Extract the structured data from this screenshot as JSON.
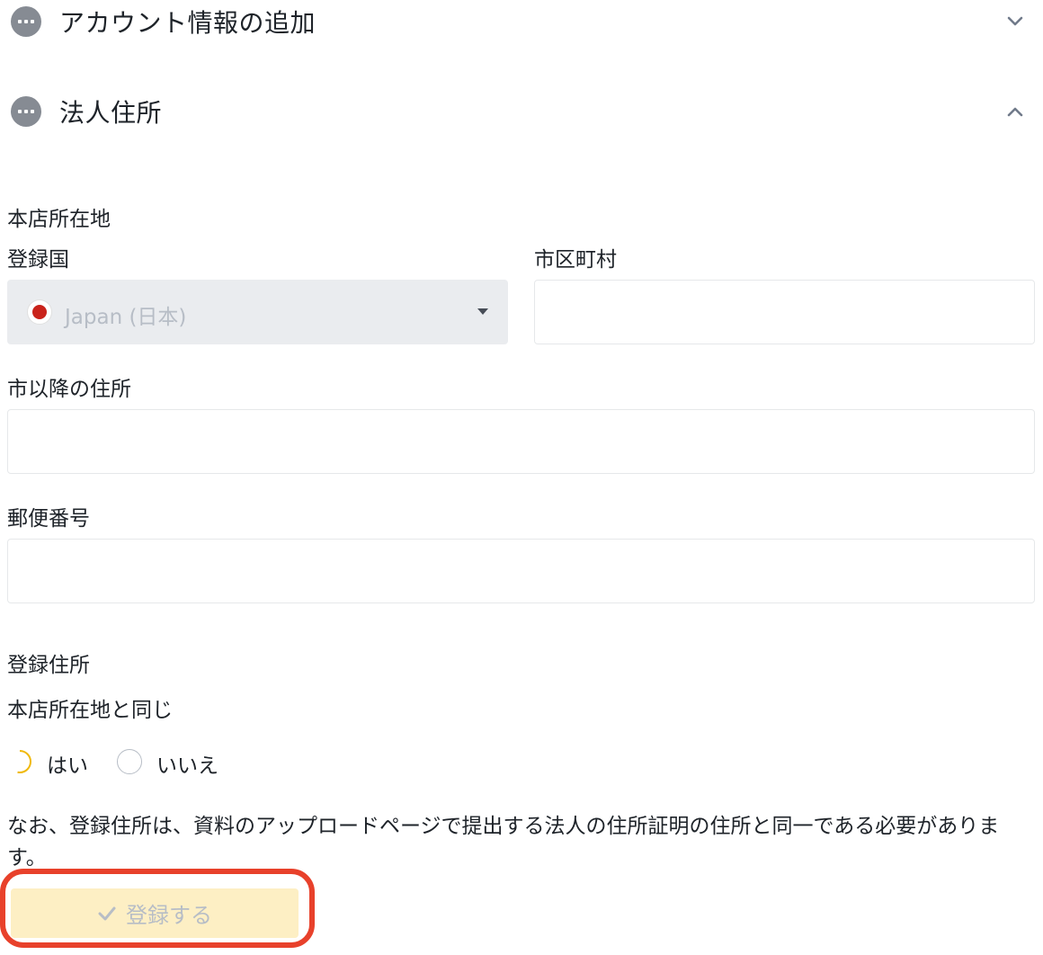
{
  "sections": {
    "account_info": {
      "title": "アカウント情報の追加",
      "expanded": false
    },
    "corporate_address": {
      "title": "法人住所",
      "expanded": true
    }
  },
  "form": {
    "head_office_heading": "本店所在地",
    "country": {
      "label": "登録国",
      "value": "Japan (日本)",
      "flag": "japan-flag-icon"
    },
    "city": {
      "label": "市区町村",
      "value": "",
      "placeholder": ""
    },
    "address_after_city": {
      "label": "市以降の住所",
      "value": "",
      "placeholder": ""
    },
    "postal_code": {
      "label": "郵便番号",
      "value": "",
      "placeholder": ""
    },
    "registered_address_heading": "登録住所",
    "same_as_head_office": {
      "question": "本店所在地と同じ",
      "options": [
        "はい",
        "いいえ"
      ]
    },
    "note": "なお、登録住所は、資料のアップロードページで提出する法人の住所証明の住所と同一である必要があります。",
    "submit_label": "登録する"
  },
  "colors": {
    "accent_yellow": "#fcd535",
    "button_disabled_bg": "#fdefc4",
    "highlight_red": "#e8412b",
    "muted_text": "#b7bdc6"
  }
}
